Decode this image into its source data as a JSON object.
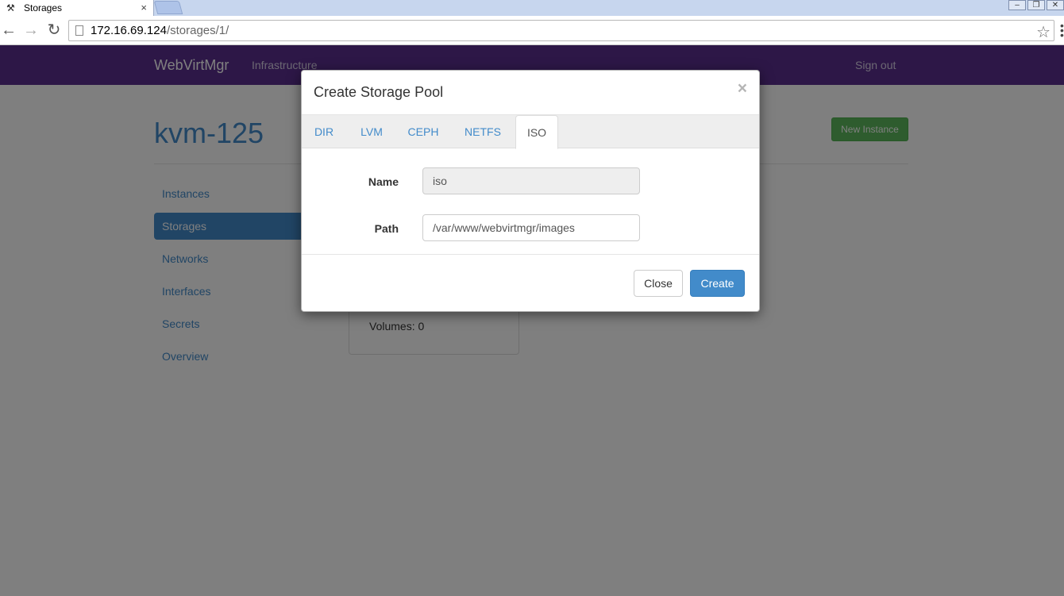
{
  "browser": {
    "tab_title": "Storages",
    "tab_close": "×",
    "url_host": "172.16.69.124",
    "url_path": "/storages/1/"
  },
  "navbar": {
    "brand": "WebVirtMgr",
    "infrastructure": "Infrastructure",
    "sign_out": "Sign out",
    "bg_color": "#5b2e8f"
  },
  "header": {
    "host_title": "kvm-125",
    "new_instance": "New Instance"
  },
  "sidebar": {
    "items": [
      {
        "label": "Instances",
        "active": false
      },
      {
        "label": "Storages",
        "active": true
      },
      {
        "label": "Networks",
        "active": false
      },
      {
        "label": "Interfaces",
        "active": false
      },
      {
        "label": "Secrets",
        "active": false
      },
      {
        "label": "Overview",
        "active": false
      }
    ]
  },
  "pool_card": {
    "volumes": "Volumes: 0"
  },
  "modal": {
    "title": "Create Storage Pool",
    "close_x": "×",
    "tabs": [
      "DIR",
      "LVM",
      "CEPH",
      "NETFS",
      "ISO"
    ],
    "active_tab": "ISO",
    "fields": {
      "name_label": "Name",
      "name_value": "iso",
      "path_label": "Path",
      "path_value": "/var/www/webvirtmgr/images"
    },
    "close_button": "Close",
    "create_button": "Create"
  },
  "colors": {
    "accent": "#428bca",
    "success": "#5cb85c"
  }
}
